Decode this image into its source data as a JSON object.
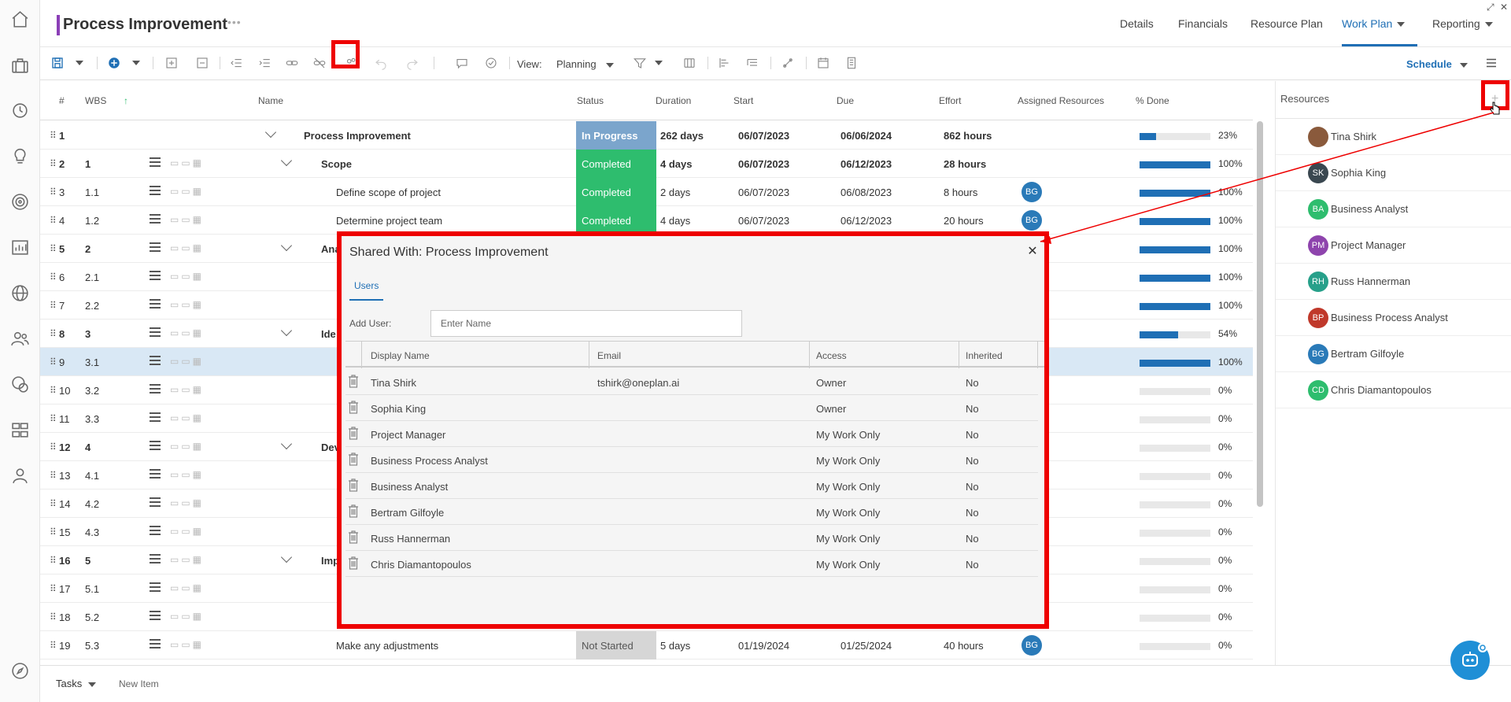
{
  "header": {
    "title": "Process Improvement",
    "title_menu": "•••",
    "nav": [
      "Details",
      "Financials",
      "Resource Plan",
      "Work Plan",
      "Reporting"
    ],
    "active_nav": "Work Plan"
  },
  "toolbar": {
    "view_label": "View:",
    "view_value": "Planning",
    "schedule_label": "Schedule"
  },
  "grid": {
    "columns": [
      "#",
      "WBS",
      "Name",
      "Status",
      "Duration",
      "Start",
      "Due",
      "Effort",
      "Assigned Resources",
      "% Done"
    ],
    "rows": [
      {
        "num": "1",
        "wbs": "",
        "name": "Process Improvement",
        "status": "In Progress",
        "duration": "262 days",
        "start": "06/07/2023",
        "due": "06/06/2024",
        "effort": "862 hours",
        "assigned": "",
        "pct": "23%",
        "pct_value": 23,
        "bold": true
      },
      {
        "num": "2",
        "wbs": "1",
        "name": "Scope",
        "status": "Completed",
        "duration": "4 days",
        "start": "06/07/2023",
        "due": "06/12/2023",
        "effort": "28 hours",
        "assigned": "",
        "pct": "100%",
        "pct_value": 100,
        "bold": true
      },
      {
        "num": "3",
        "wbs": "1.1",
        "name": "Define scope of project",
        "status": "Completed",
        "duration": "2 days",
        "start": "06/07/2023",
        "due": "06/08/2023",
        "effort": "8 hours",
        "assigned": "BG",
        "pct": "100%",
        "pct_value": 100,
        "bold": false
      },
      {
        "num": "4",
        "wbs": "1.2",
        "name": "Determine project team",
        "status": "Completed",
        "duration": "4 days",
        "start": "06/07/2023",
        "due": "06/12/2023",
        "effort": "20 hours",
        "assigned": "BG",
        "pct": "100%",
        "pct_value": 100,
        "bold": false
      },
      {
        "num": "5",
        "wbs": "2",
        "name": "Ana",
        "status": "",
        "duration": "",
        "start": "",
        "due": "",
        "effort": "",
        "assigned": "",
        "pct": "100%",
        "pct_value": 100,
        "bold": true
      },
      {
        "num": "6",
        "wbs": "2.1",
        "name": "",
        "status": "",
        "duration": "",
        "start": "",
        "due": "",
        "effort": "",
        "assigned": "",
        "pct": "100%",
        "pct_value": 100,
        "bold": false
      },
      {
        "num": "7",
        "wbs": "2.2",
        "name": "",
        "status": "",
        "duration": "",
        "start": "",
        "due": "",
        "effort": "",
        "assigned": "",
        "pct": "100%",
        "pct_value": 100,
        "bold": false
      },
      {
        "num": "8",
        "wbs": "3",
        "name": "Ide",
        "status": "",
        "duration": "",
        "start": "",
        "due": "",
        "effort": "",
        "assigned": "",
        "pct": "54%",
        "pct_value": 54,
        "bold": true
      },
      {
        "num": "9",
        "wbs": "3.1",
        "name": "",
        "status": "",
        "duration": "",
        "start": "",
        "due": "",
        "effort": "",
        "assigned": "",
        "pct": "100%",
        "pct_value": 100,
        "bold": false
      },
      {
        "num": "10",
        "wbs": "3.2",
        "name": "",
        "status": "",
        "duration": "",
        "start": "",
        "due": "",
        "effort": "",
        "assigned": "",
        "pct": "0%",
        "pct_value": 0,
        "bold": false
      },
      {
        "num": "11",
        "wbs": "3.3",
        "name": "",
        "status": "",
        "duration": "",
        "start": "",
        "due": "",
        "effort": "",
        "assigned": "",
        "pct": "0%",
        "pct_value": 0,
        "bold": false
      },
      {
        "num": "12",
        "wbs": "4",
        "name": "Dev",
        "status": "",
        "duration": "",
        "start": "",
        "due": "",
        "effort": "",
        "assigned": "",
        "pct": "0%",
        "pct_value": 0,
        "bold": true
      },
      {
        "num": "13",
        "wbs": "4.1",
        "name": "",
        "status": "",
        "duration": "",
        "start": "",
        "due": "",
        "effort": "",
        "assigned": "",
        "pct": "0%",
        "pct_value": 0,
        "bold": false
      },
      {
        "num": "14",
        "wbs": "4.2",
        "name": "",
        "status": "",
        "duration": "",
        "start": "",
        "due": "",
        "effort": "",
        "assigned": "",
        "pct": "0%",
        "pct_value": 0,
        "bold": false
      },
      {
        "num": "15",
        "wbs": "4.3",
        "name": "",
        "status": "",
        "duration": "",
        "start": "",
        "due": "",
        "effort": "",
        "assigned": "",
        "pct": "0%",
        "pct_value": 0,
        "bold": false
      },
      {
        "num": "16",
        "wbs": "5",
        "name": "Imp",
        "status": "",
        "duration": "",
        "start": "",
        "due": "",
        "effort": "",
        "assigned": "",
        "pct": "0%",
        "pct_value": 0,
        "bold": true
      },
      {
        "num": "17",
        "wbs": "5.1",
        "name": "",
        "status": "",
        "duration": "",
        "start": "",
        "due": "",
        "effort": "",
        "assigned": "",
        "pct": "0%",
        "pct_value": 0,
        "bold": false
      },
      {
        "num": "18",
        "wbs": "5.2",
        "name": "",
        "status": "",
        "duration": "",
        "start": "",
        "due": "",
        "effort": "",
        "assigned": "",
        "pct": "0%",
        "pct_value": 0,
        "bold": false
      },
      {
        "num": "19",
        "wbs": "5.3",
        "name": "Make any adjustments",
        "status": "Not Started",
        "duration": "5 days",
        "start": "01/19/2024",
        "due": "01/25/2024",
        "effort": "40 hours",
        "assigned": "BG",
        "pct": "0%",
        "pct_value": 0,
        "bold": false
      }
    ]
  },
  "resources": {
    "title": "Resources",
    "items": [
      {
        "name": "Tina Shirk",
        "initials": "",
        "color": "#8a5a3c"
      },
      {
        "name": "Sophia King",
        "initials": "SK",
        "color": "#3a4750"
      },
      {
        "name": "Business Analyst",
        "initials": "BA",
        "color": "#2ebd6e"
      },
      {
        "name": "Project Manager",
        "initials": "PM",
        "color": "#8e44ad"
      },
      {
        "name": "Russ Hannerman",
        "initials": "RH",
        "color": "#27a08a"
      },
      {
        "name": "Business Process Analyst",
        "initials": "BP",
        "color": "#c0392b"
      },
      {
        "name": "Bertram Gilfoyle",
        "initials": "BG",
        "color": "#2a7ab8"
      },
      {
        "name": "Chris Diamantopoulos",
        "initials": "CD",
        "color": "#2ebd6e"
      }
    ]
  },
  "dialog": {
    "title": "Shared With: Process Improvement",
    "tab": "Users",
    "add_user_label": "Add User:",
    "add_user_placeholder": "Enter Name",
    "columns": [
      "Display Name",
      "Email",
      "Access",
      "Inherited"
    ],
    "rows": [
      {
        "name": "Tina Shirk",
        "email": "tshirk@oneplan.ai",
        "access": "Owner",
        "inherited": "No"
      },
      {
        "name": "Sophia King",
        "email": "",
        "access": "Owner",
        "inherited": "No"
      },
      {
        "name": "Project Manager",
        "email": "",
        "access": "My Work Only",
        "inherited": "No"
      },
      {
        "name": "Business Process Analyst",
        "email": "",
        "access": "My Work Only",
        "inherited": "No"
      },
      {
        "name": "Business Analyst",
        "email": "",
        "access": "My Work Only",
        "inherited": "No"
      },
      {
        "name": "Bertram Gilfoyle",
        "email": "",
        "access": "My Work Only",
        "inherited": "No"
      },
      {
        "name": "Russ Hannerman",
        "email": "",
        "access": "My Work Only",
        "inherited": "No"
      },
      {
        "name": "Chris Diamantopoulos",
        "email": "",
        "access": "My Work Only",
        "inherited": "No"
      }
    ]
  },
  "bottom": {
    "tasks_label": "Tasks",
    "new_item_label": "New Item"
  },
  "colors": {
    "accent": "#1f6fb5",
    "title_accent": "#8b3fb7",
    "completed": "#2ebd6e",
    "in_progress": "#7ba5cc",
    "not_started": "#d6d6d6",
    "highlight": "#ee0000"
  }
}
